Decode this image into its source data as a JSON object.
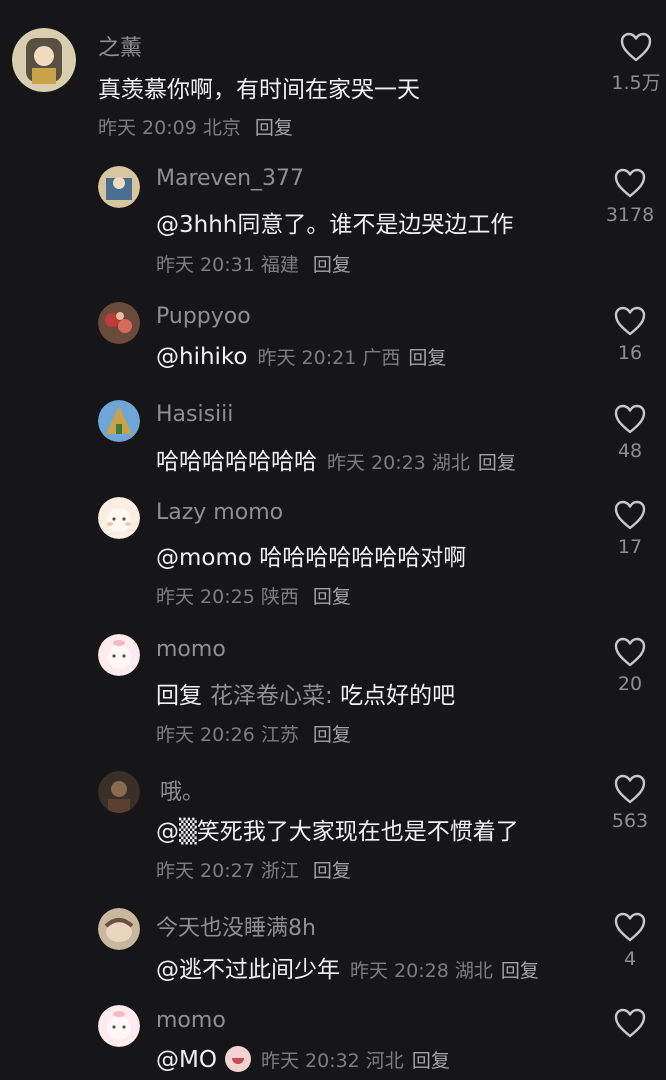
{
  "comments": [
    {
      "username": "之薰",
      "text": "真羡慕你啊，有时间在家哭一天",
      "time": "昨天 20:09",
      "location": "北京",
      "reply_label": "回复",
      "likes": "1.5万",
      "avatar_colors": [
        "#c9b98a",
        "#5a5040"
      ]
    },
    {
      "username": "Mareven_377",
      "text": "@3hhh同意了。谁不是边哭边工作",
      "time": "昨天 20:31",
      "location": "福建",
      "reply_label": "回复",
      "likes": "3178",
      "avatar_colors": [
        "#d8c6a0",
        "#4a6e92"
      ]
    },
    {
      "username": "Puppyoo",
      "text": "@hihiko",
      "time": "昨天 20:21",
      "location": "广西",
      "reply_label": "回复",
      "likes": "16",
      "avatar_colors": [
        "#8a4a3a",
        "#c03a3a"
      ]
    },
    {
      "username": "Hasisiii",
      "text": "哈哈哈哈哈哈哈",
      "time": "昨天 20:23",
      "location": "湖北",
      "reply_label": "回复",
      "likes": "48",
      "avatar_colors": [
        "#6fa6d8",
        "#c9a24a"
      ]
    },
    {
      "username": "Lazy momo",
      "text": "@momo 哈哈哈哈哈哈哈对啊",
      "time": "昨天 20:25",
      "location": "陕西",
      "reply_label": "回复",
      "likes": "17",
      "avatar_colors": [
        "#fbeee2",
        "#f2c7b8"
      ]
    },
    {
      "username": "momo",
      "reply_prefix": "回复",
      "reply_target": "花泽卷心菜:",
      "text": "吃点好的吧",
      "time": "昨天 20:26",
      "location": "江苏",
      "reply_label": "回复",
      "likes": "20",
      "avatar_colors": [
        "#fdebee",
        "#f5b9c4"
      ]
    },
    {
      "username": "哦。",
      "text": "@▒笑死我了大家现在也是不惯着了",
      "time": "昨天 20:27",
      "location": "浙江",
      "reply_label": "回复",
      "likes": "563",
      "avatar_colors": [
        "#4a3a30",
        "#8a6a50"
      ]
    },
    {
      "username": "今天也没睡满8h",
      "text": "@逃不过此间少年",
      "time": "昨天 20:28",
      "location": "湖北",
      "reply_label": "回复",
      "likes": "4",
      "avatar_colors": [
        "#c9b7a0",
        "#6a5040"
      ]
    },
    {
      "username": "momo",
      "text": "@MO",
      "time": "昨天 20:32",
      "location": "河北",
      "reply_label": "回复",
      "likes": "",
      "avatar_colors": [
        "#fdebee",
        "#f5b9c4"
      ]
    }
  ]
}
